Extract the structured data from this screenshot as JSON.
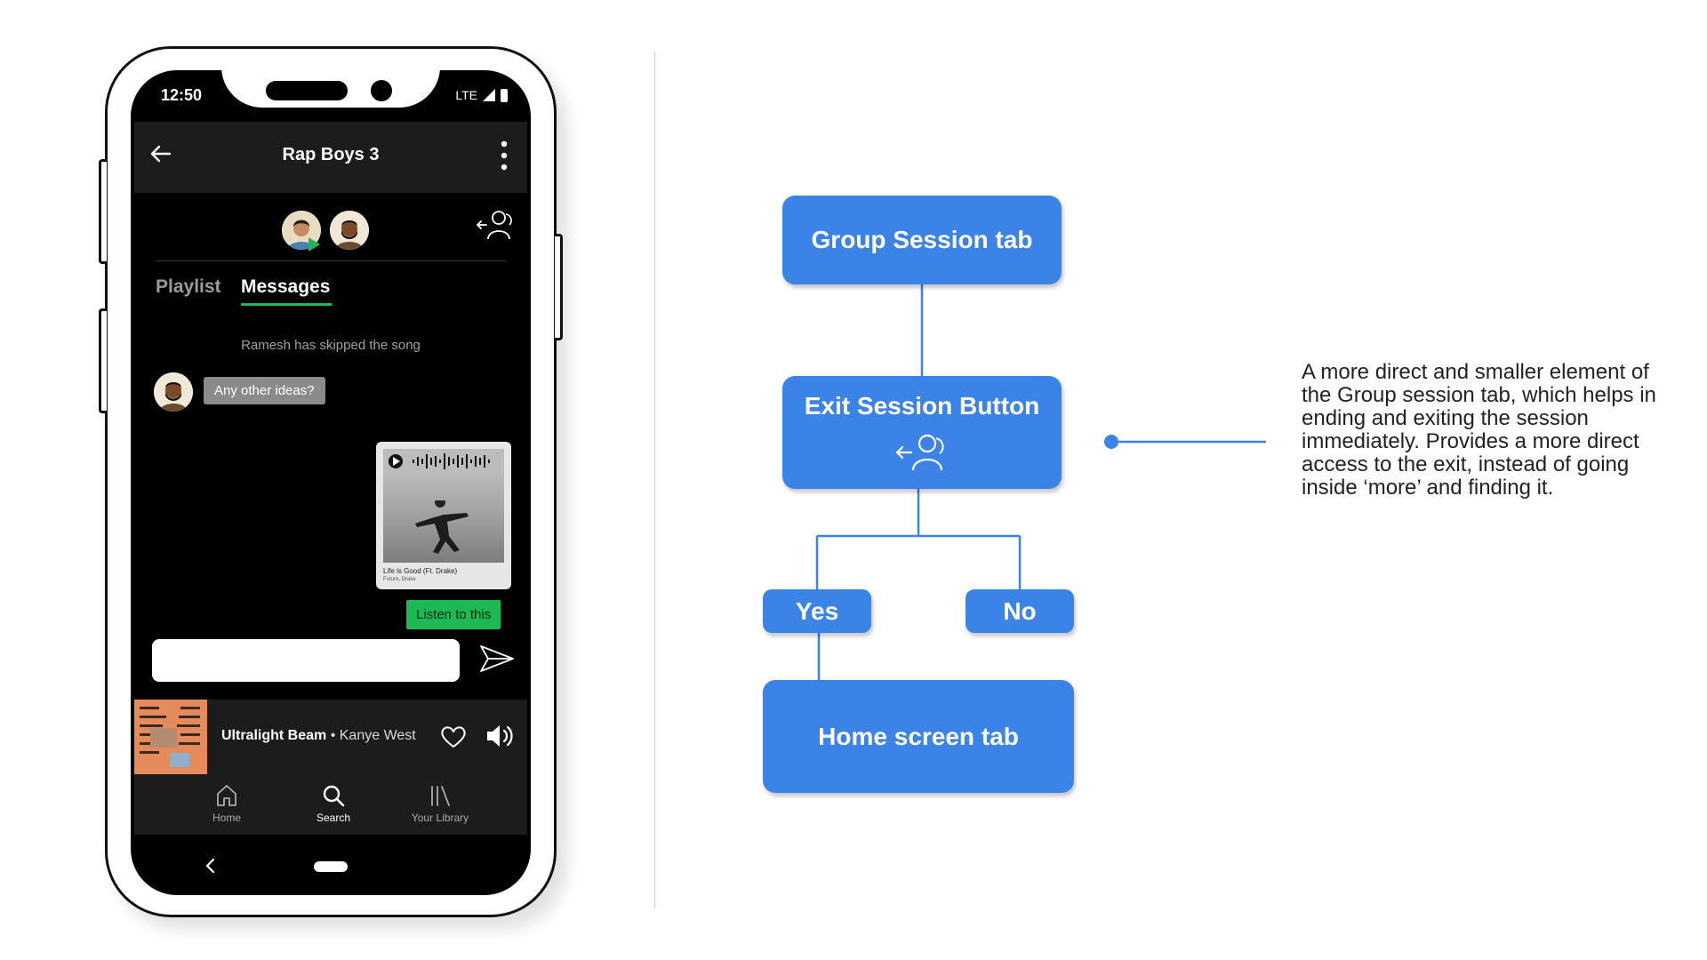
{
  "phone": {
    "status": {
      "time": "12:50",
      "network": "LTE"
    },
    "header": {
      "title": "Rap Boys 3"
    },
    "tabs": [
      {
        "label": "Playlist",
        "active": false
      },
      {
        "label": "Messages",
        "active": true
      }
    ],
    "system_message": "Ramesh has skipped the song",
    "chat_message": "Any other ideas?",
    "shared_song": {
      "title": "Life is Good (Ft. Drake)",
      "artists": "Future, Drake"
    },
    "listen_button": "Listen to this",
    "message_input": {
      "placeholder": ""
    },
    "now_playing": {
      "song": "Ultralight Beam",
      "separator": " • ",
      "artist": "Kanye West"
    },
    "nav": [
      {
        "label": "Home",
        "icon": "home-icon"
      },
      {
        "label": "Search",
        "icon": "search-icon"
      },
      {
        "label": "Your Library",
        "icon": "library-icon"
      }
    ]
  },
  "flowchart": {
    "nodes": {
      "group_session": "Group Session tab",
      "exit_session": "Exit Session Button",
      "yes": "Yes",
      "no": "No",
      "home_screen": "Home screen tab"
    },
    "colors": {
      "node": "#3b83e6",
      "line": "#3b83e6"
    }
  },
  "annotation": "A more direct and smaller element of the Group session tab, which helps in ending and exiting the session immediately. Provides a more direct access to the exit, instead of going inside ‘more’ and finding it.",
  "colors": {
    "spotify_green": "#1db954",
    "screen_bg": "#000000",
    "bar_bg": "#1c1c1c"
  }
}
